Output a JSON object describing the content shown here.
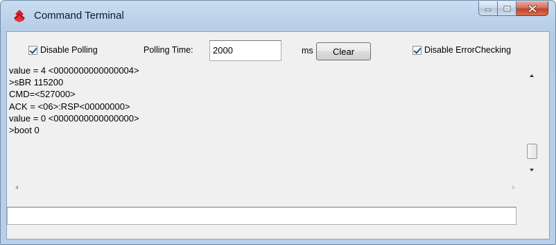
{
  "window": {
    "title": "Command Terminal",
    "app_icon": "red-diamond-chevron-icon",
    "accent_color": "#c8102e"
  },
  "toolbar": {
    "disable_polling": {
      "label": "Disable Polling",
      "checked": true
    },
    "polling_time_label": "Polling Time:",
    "polling_time_value": "2000",
    "polling_unit": "ms",
    "clear_label": "Clear",
    "disable_error_checking": {
      "label": "Disable ErrorChecking",
      "checked": true
    }
  },
  "console": {
    "lines": [
      "value = 4 <0000000000000004>",
      ">sBR 115200",
      "CMD=<527000>",
      "ACK = <06>:RSP<00000000>",
      "value = 0 <0000000000000000>",
      ">boot 0"
    ]
  },
  "command_input": {
    "value": "",
    "placeholder": ""
  }
}
